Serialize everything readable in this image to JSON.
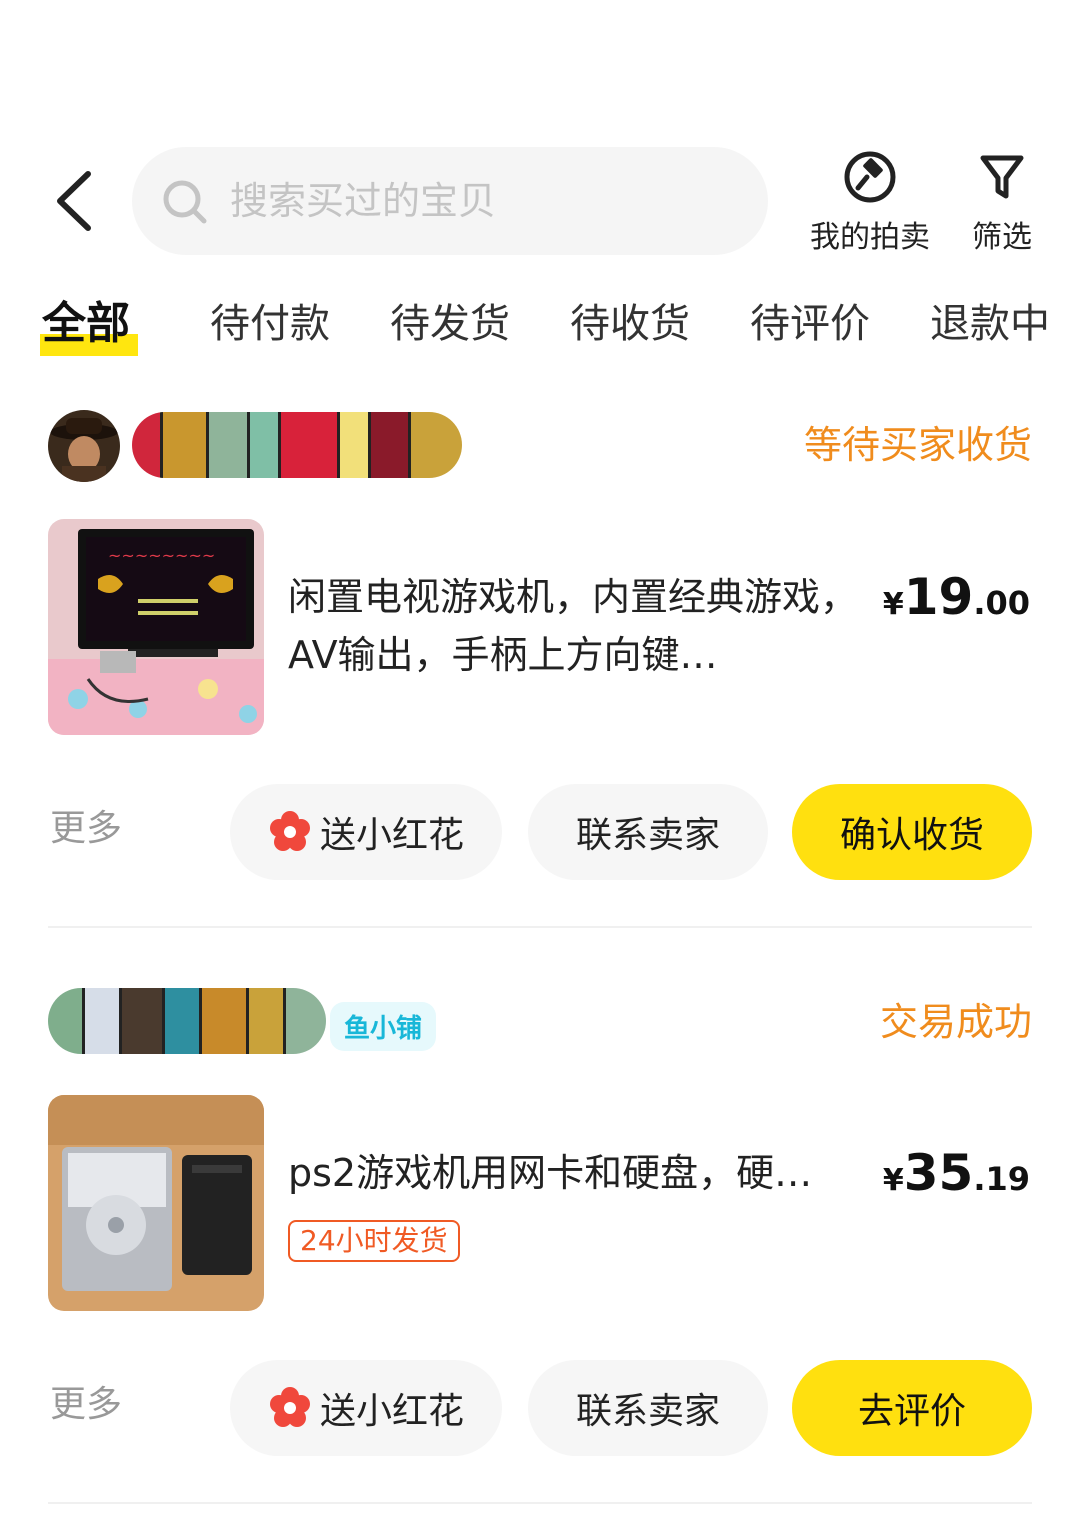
{
  "header": {
    "search_placeholder": "搜索买过的宝贝",
    "auction_label": "我的拍卖",
    "filter_label": "筛选"
  },
  "tabs": [
    "全部",
    "待付款",
    "待发货",
    "待收货",
    "待评价",
    "退款中"
  ],
  "orders": [
    {
      "status": "等待买家收货",
      "title": "闲置电视游戏机，内置经典游戏，AV输出，手柄上方向键…",
      "price_symbol": "¥",
      "price_int": "19",
      "price_dec": ".00",
      "more": "更多",
      "btn_flower": "送小红花",
      "btn_contact": "联系卖家",
      "btn_primary": "确认收货"
    },
    {
      "shop_tag": "鱼小铺",
      "status": "交易成功",
      "title": "ps2游戏机用网卡和硬盘，硬…",
      "ship_tag": "24小时发货",
      "price_symbol": "¥",
      "price_int": "35",
      "price_dec": ".19",
      "more": "更多",
      "btn_flower": "送小红花",
      "btn_contact": "联系卖家",
      "btn_primary": "去评价"
    }
  ],
  "colors": {
    "accent_yellow": "#ffe00f",
    "status_orange": "#f08c1d",
    "shop_tag_cyan": "#18b7d8",
    "ship_tag_red": "#f05a24"
  }
}
